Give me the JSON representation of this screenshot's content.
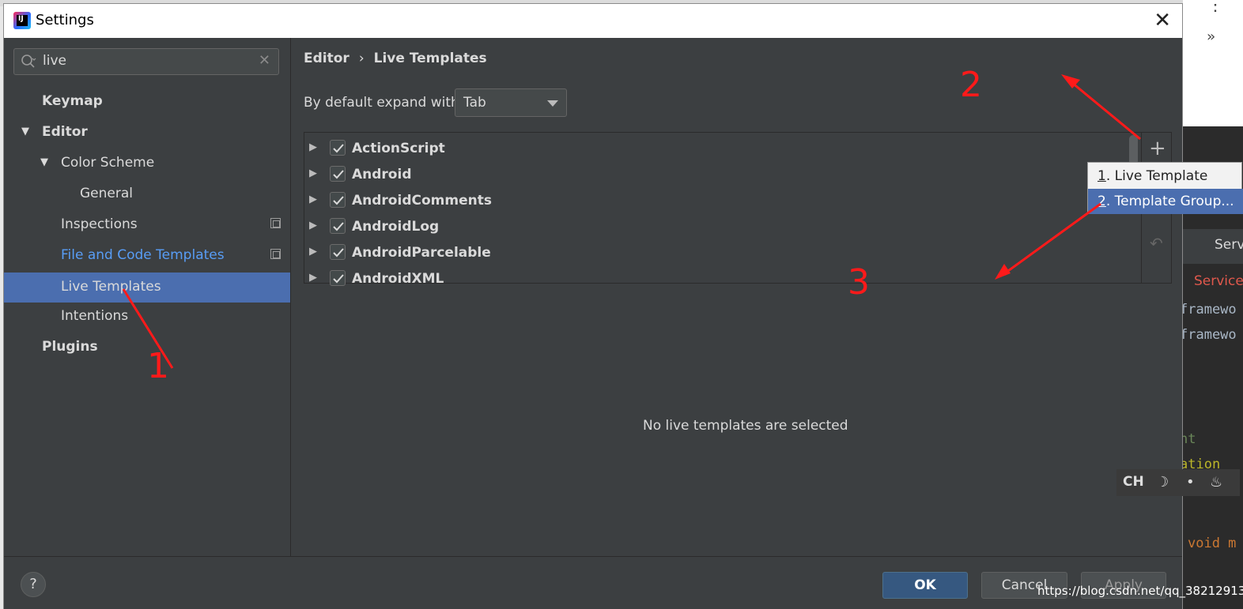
{
  "window": {
    "title": "Settings",
    "close": "✕"
  },
  "search": {
    "value": "live",
    "clear": "✕"
  },
  "sidebar": {
    "items": [
      {
        "label": "Keymap"
      },
      {
        "label": "Editor",
        "toggle": "▼"
      },
      {
        "label": "Color Scheme",
        "toggle": "▼"
      },
      {
        "label": "General"
      },
      {
        "label": "Inspections"
      },
      {
        "label": "File and Code Templates"
      },
      {
        "label": "Live Templates"
      },
      {
        "label": "Intentions"
      },
      {
        "label": "Plugins"
      }
    ]
  },
  "breadcrumb": {
    "first": "Editor",
    "sep": "›",
    "second": "Live Templates"
  },
  "expand": {
    "label": "By default expand with",
    "value": "Tab"
  },
  "groups": [
    {
      "name": "ActionScript",
      "checked": true
    },
    {
      "name": "Android",
      "checked": true
    },
    {
      "name": "AndroidComments",
      "checked": true
    },
    {
      "name": "AndroidLog",
      "checked": true
    },
    {
      "name": "AndroidParcelable",
      "checked": true
    },
    {
      "name": "AndroidXML",
      "checked": true
    }
  ],
  "tree_arrow": "▶",
  "toolbar": {
    "add": "+",
    "undo": "↶"
  },
  "popup": {
    "items": [
      {
        "num": "1",
        "label": ". Live Template"
      },
      {
        "num": "2",
        "label": ". Template Group..."
      }
    ]
  },
  "empty_message": "No live templates are selected",
  "buttons": {
    "help": "?",
    "ok": "OK",
    "cancel": "Cancel",
    "apply": "Apply"
  },
  "annotations": [
    "1",
    "2",
    "3"
  ],
  "background": {
    "lines": [
      "Serv",
      "Service",
      "framewo",
      "framewo",
      "nt",
      "ation",
      "l",
      "void m"
    ],
    "ime": {
      "label": "CH",
      "icons": [
        "☽",
        "•",
        "♨"
      ]
    },
    "top_right": [
      "⋮",
      "»"
    ]
  },
  "watermark": "https://blog.csdn.net/qq_38212913",
  "colors": {
    "selected": "#4b6eaf",
    "link": "#589df6",
    "panel": "#3c3f41",
    "annotation": "#ff1a1a"
  }
}
